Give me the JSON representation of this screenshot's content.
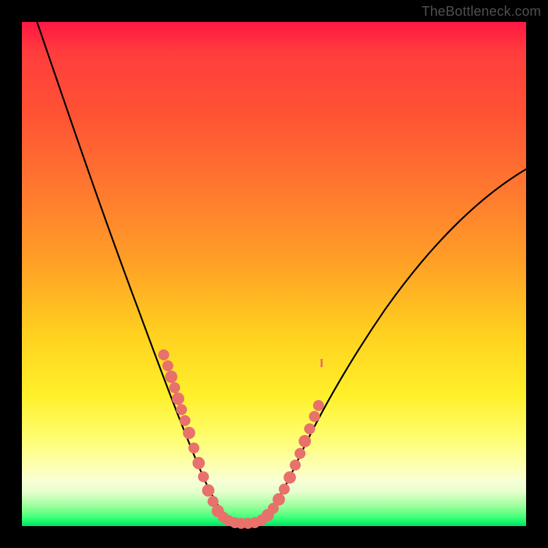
{
  "watermark": "TheBottleneck.com",
  "chart_data": {
    "type": "line",
    "title": "",
    "xlabel": "",
    "ylabel": "",
    "xlim": [
      0,
      100
    ],
    "ylim": [
      0,
      100
    ],
    "note": "No axis ticks or numeric labels are rendered in the image; values below are normalized 0–100 estimates read from pixel positions (y=0 bottom, y=100 top).",
    "series": [
      {
        "name": "bottleneck-curve",
        "x": [
          3,
          5,
          8,
          11,
          14,
          17,
          20,
          23,
          26,
          29,
          31,
          33,
          35,
          37,
          38.5,
          40,
          41.5,
          43,
          45,
          48,
          51,
          54,
          58,
          62,
          66,
          70,
          75,
          80,
          86,
          92,
          98
        ],
        "y": [
          100,
          94,
          86,
          78,
          70,
          62,
          54,
          46,
          38,
          31,
          25,
          20,
          15,
          10,
          6,
          3,
          1.5,
          1,
          1,
          2,
          5,
          10,
          17,
          24,
          31,
          38,
          45,
          52,
          59,
          65,
          70
        ]
      }
    ],
    "scatter_overlay": {
      "name": "highlighted-points",
      "note": "Salmon dots clustered near the valley on both sides of the minimum; positions estimated.",
      "x": [
        28,
        29,
        29.5,
        30,
        30.5,
        31,
        31.5,
        32,
        33,
        34,
        35,
        36,
        37,
        38,
        39,
        40,
        41,
        42,
        43,
        44,
        45,
        46,
        47,
        48,
        49,
        50,
        51,
        52,
        53,
        54,
        55,
        56
      ],
      "y": [
        34,
        31,
        29,
        27,
        25,
        23,
        21,
        19,
        16,
        13,
        10,
        8,
        6,
        4,
        2.5,
        1.8,
        1.3,
        1.1,
        1,
        1,
        1.2,
        1.8,
        2.5,
        4,
        6,
        8,
        10.5,
        13,
        16,
        19,
        22,
        25
      ],
      "color": "#e8716b"
    },
    "background_gradient": {
      "top": "#ff1744",
      "mid_upper": "#ff8a2b",
      "mid": "#ffe028",
      "lower": "#fdffb0",
      "bottom": "#00e060"
    }
  }
}
